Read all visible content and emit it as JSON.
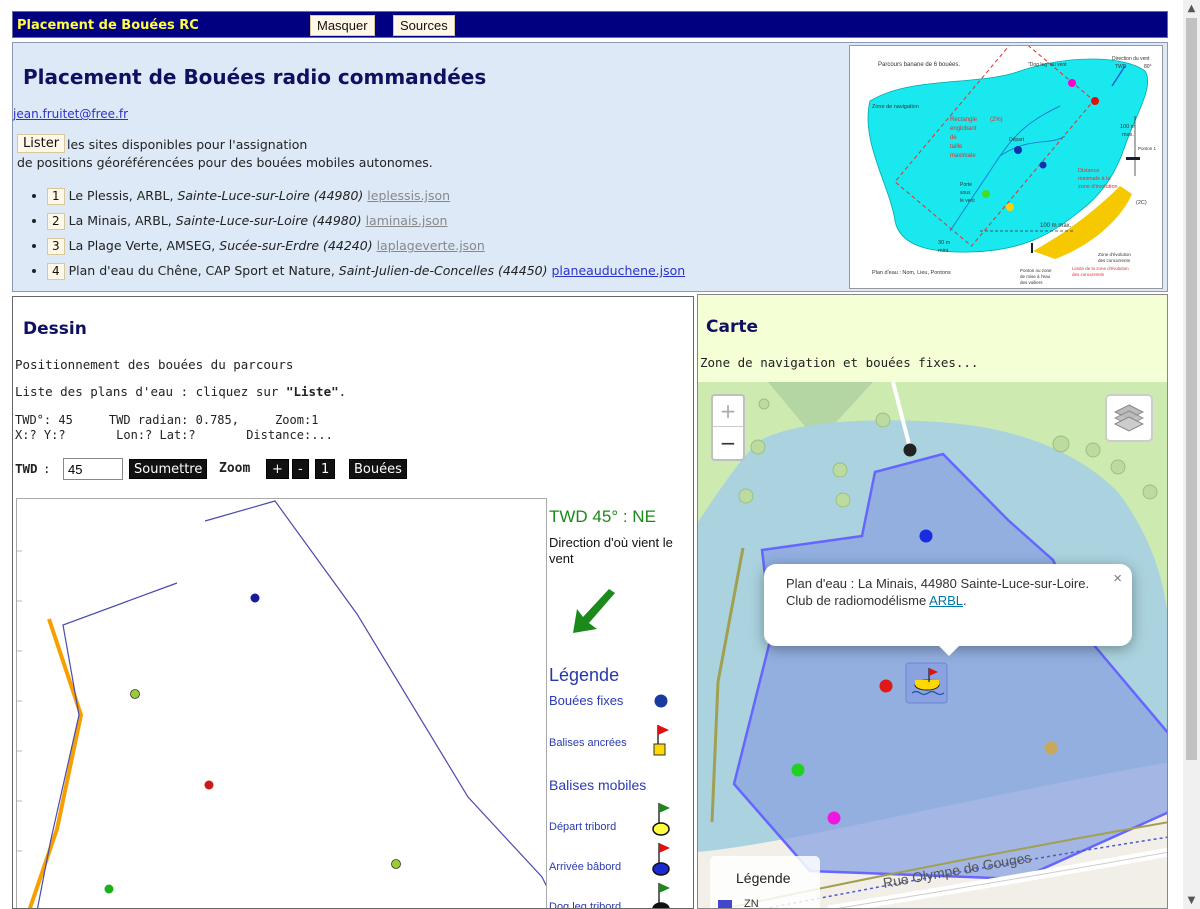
{
  "topbar": {
    "title": "Placement de Bouées RC",
    "hide_label": "Masquer",
    "sources_label": "Sources"
  },
  "header": {
    "title": "Placement de Bouées radio commandées",
    "email": "jean.fruitet@free.fr",
    "list_button": "Lister",
    "intro_line1": "les sites disponibles pour l'assignation",
    "intro_line2": "de positions géoréférencées pour des bouées mobiles autonomes.",
    "sites": [
      {
        "num": "1",
        "name": "Le Plessis, ARBL, ",
        "town": "Sainte-Luce-sur-Loire (44980)",
        "file": "leplessis.json"
      },
      {
        "num": "2",
        "name": "La Minais, ARBL, ",
        "town": "Sainte-Luce-sur-Loire (44980)",
        "file": "laminais.json"
      },
      {
        "num": "3",
        "name": "La Plage Verte, AMSEG, ",
        "town": "Sucée-sur-Erdre (44240)",
        "file": "laplageverte.json"
      },
      {
        "num": "4",
        "name": "Plan d'eau du Chêne, CAP Sport et Nature, ",
        "town": "Saint-Julien-de-Concelles (44450)",
        "file": "planeauduchene.json"
      }
    ]
  },
  "diagram": {
    "title": "Parcours banane de 6 bouées.",
    "wind": "Direction du vent",
    "twd": "TWD",
    "twd_value": "80°",
    "dog_leg": "\"Dog leg\" au vent",
    "zone": "Zone de navigation",
    "rect1": "Rectangle",
    "rect2": "(2%)",
    "rect3": "englobant",
    "rect4": "de",
    "rect5": "taille",
    "rect6": "maximale",
    "depart": "Départ",
    "porte": "Porte",
    "sous": "sous",
    "vent": "le vent",
    "d100": "100 m",
    "max": "max.",
    "d100max": "100 m max.",
    "ponton": "Ponton 1",
    "dist1": "Distance",
    "dist2": "minimale à la",
    "dist3": "zone d'évolution",
    "two_c": "(2C)",
    "d30": "30 m",
    "mini": "mini",
    "zone_evol1": "Zone d'évolution",
    "zone_evol2": "des concurrents",
    "limite1": "Limite de la zone d'évolution",
    "limite2": "des concurrents",
    "ponton_zone1": "Ponton ou zone",
    "ponton_zone2": "de mise à l'eau",
    "ponton_zone3": "des voiliers",
    "plan": "Plan d'eau : Nom, Lieu, Pontons"
  },
  "dessin": {
    "title": "Dessin",
    "subtitle": "Positionnement des bouées du parcours",
    "list_prefix": "Liste des plans d'eau : cliquez sur ",
    "list_word": "\"Liste\"",
    "list_suffix": ".",
    "info_line1": "TWD°: 45     TWD radian: 0.785,     Zoom:1",
    "info_line2": "X:? Y:?       Lon:? Lat:?       Distance:...",
    "twd_label": "TWD",
    "twd_colon": " :",
    "twd_value": "45",
    "submit_label": "Soumettre",
    "zoom_label": "Zoom",
    "zoom_plus": "+",
    "zoom_minus": "-",
    "zoom_one": "1",
    "buoys_label": "Bouées",
    "twd_heading": "TWD 45° : NE",
    "twd_description": "Direction d'où vient le vent",
    "legend_title": "Légende",
    "legend_fixed": "Bouées fixes",
    "legend_anchored": "Balises ancrées",
    "legend_mobile": "Balises mobiles",
    "legend_start": "Départ tribord",
    "legend_finish": "Arrivée bâbord",
    "legend_dogleg": "Dog leg tribord"
  },
  "carte": {
    "title": "Carte",
    "subtitle": "Zone de navigation et bouées fixes...",
    "zoom_in": "+",
    "zoom_out": "−",
    "popup_text": "Plan d'eau : La Minais, 44980 Sainte-Luce-sur-Loire.",
    "popup_club": "Club de radiomodélisme ",
    "popup_link": "ARBL",
    "popup_end": ".",
    "popup_close": "×",
    "legend_title": "Légende",
    "legend_zn": "ZN",
    "street": "Rue Olympe de Gouges"
  },
  "scrollbar": {
    "up": "▲",
    "down": "▼"
  },
  "colors": {
    "topbar_bg": "#000080",
    "topbar_title": "#ffff40",
    "header_bg": "#dde9f7",
    "map_water": "#9ab0e4",
    "zone_outline": "#6666ff",
    "shore": "#f5a000",
    "twd_green": "#1b8a1b"
  }
}
